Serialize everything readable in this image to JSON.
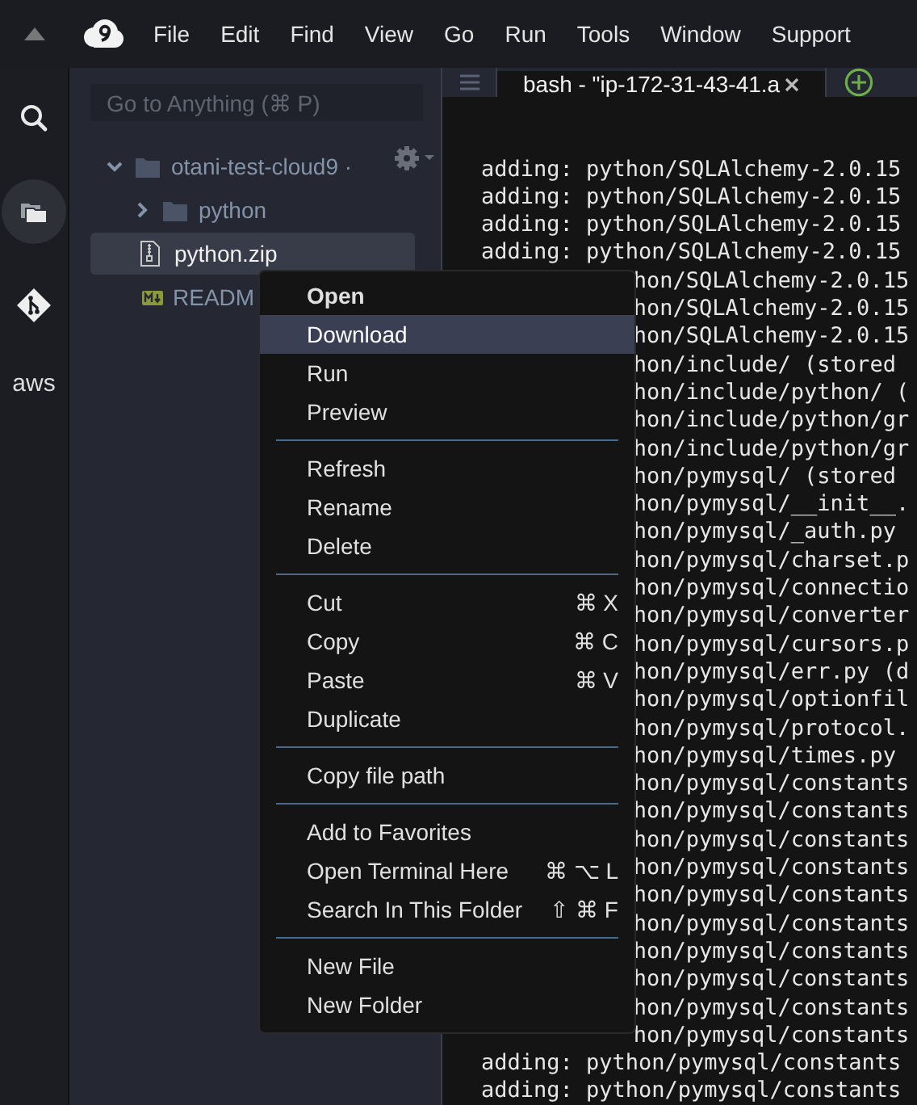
{
  "menubar": {
    "items": [
      "File",
      "Edit",
      "Find",
      "View",
      "Go",
      "Run",
      "Tools",
      "Window",
      "Support"
    ]
  },
  "rail": [
    {
      "kind": "search",
      "selected": false
    },
    {
      "kind": "files",
      "selected": true
    },
    {
      "kind": "git",
      "selected": false
    },
    {
      "kind": "aws",
      "label": "aws",
      "selected": false
    }
  ],
  "sidebar": {
    "search": {
      "placeholder": "Go to Anything (⌘ P)"
    },
    "tree": {
      "label": "otani-test-cloud9 ·",
      "expanded": true,
      "children": [
        {
          "label": "python",
          "kind": "folder",
          "expanded": false,
          "selected": false
        },
        {
          "label": "python.zip",
          "kind": "zip",
          "selected": true
        },
        {
          "label": "READM",
          "kind": "markdown",
          "selected": false
        }
      ]
    }
  },
  "terminal": {
    "tabs": [
      {
        "label": "bash - \"ip-172-31-43-41.a",
        "selected": true
      }
    ],
    "lines": [
      {
        "kind": "full",
        "text": "adding: python/SQLAlchemy-2.0.15"
      },
      {
        "kind": "full",
        "text": "adding: python/SQLAlchemy-2.0.15"
      },
      {
        "kind": "full",
        "text": "adding: python/SQLAlchemy-2.0.15"
      },
      {
        "kind": "full",
        "text": "adding: python/SQLAlchemy-2.0.15"
      },
      {
        "kind": "partial",
        "text": "hon/SQLAlchemy-2.0.15"
      },
      {
        "kind": "partial",
        "text": "hon/SQLAlchemy-2.0.15"
      },
      {
        "kind": "partial",
        "text": "hon/SQLAlchemy-2.0.15"
      },
      {
        "kind": "partial",
        "text": "hon/include/ (stored"
      },
      {
        "kind": "partial",
        "text": "hon/include/python/ ("
      },
      {
        "kind": "partial",
        "text": "hon/include/python/gr"
      },
      {
        "kind": "partial",
        "text": "hon/include/python/gr"
      },
      {
        "kind": "partial",
        "text": "hon/pymysql/ (stored"
      },
      {
        "kind": "partial",
        "text": "hon/pymysql/__init__."
      },
      {
        "kind": "partial",
        "text": "hon/pymysql/_auth.py"
      },
      {
        "kind": "partial",
        "text": "hon/pymysql/charset.p"
      },
      {
        "kind": "partial",
        "text": "hon/pymysql/connectio"
      },
      {
        "kind": "partial",
        "text": "hon/pymysql/converter"
      },
      {
        "kind": "partial",
        "text": "hon/pymysql/cursors.p"
      },
      {
        "kind": "partial",
        "text": "hon/pymysql/err.py (d"
      },
      {
        "kind": "partial",
        "text": "hon/pymysql/optionfil"
      },
      {
        "kind": "partial",
        "text": "hon/pymysql/protocol."
      },
      {
        "kind": "partial",
        "text": "hon/pymysql/times.py"
      },
      {
        "kind": "partial",
        "text": "hon/pymysql/constants"
      },
      {
        "kind": "partial",
        "text": "hon/pymysql/constants"
      },
      {
        "kind": "partial",
        "text": "hon/pymysql/constants"
      },
      {
        "kind": "partial",
        "text": "hon/pymysql/constants"
      },
      {
        "kind": "partial",
        "text": "hon/pymysql/constants"
      },
      {
        "kind": "partial",
        "text": "hon/pymysql/constants"
      },
      {
        "kind": "partial",
        "text": "hon/pymysql/constants"
      },
      {
        "kind": "partial",
        "text": "hon/pymysql/constants"
      },
      {
        "kind": "partial",
        "text": "hon/pymysql/constants"
      },
      {
        "kind": "partial",
        "text": "hon/pymysql/constants"
      },
      {
        "kind": "full",
        "text": "adding: python/pymysql/constants"
      },
      {
        "kind": "full",
        "text": "adding: python/pymysql/constants"
      }
    ]
  },
  "context_menu": {
    "items": [
      {
        "kind": "item",
        "label": "Open",
        "default": true,
        "selected": false
      },
      {
        "kind": "item",
        "label": "Download",
        "default": false,
        "selected": true
      },
      {
        "kind": "item",
        "label": "Run",
        "default": false,
        "selected": false
      },
      {
        "kind": "item",
        "label": "Preview",
        "default": false,
        "selected": false
      },
      {
        "kind": "separator"
      },
      {
        "kind": "item",
        "label": "Refresh",
        "default": false,
        "selected": false
      },
      {
        "kind": "item",
        "label": "Rename",
        "default": false,
        "selected": false
      },
      {
        "kind": "item",
        "label": "Delete",
        "default": false,
        "selected": false
      },
      {
        "kind": "separator"
      },
      {
        "kind": "item",
        "label": "Cut",
        "shortcut": "⌘ X",
        "default": false,
        "selected": false
      },
      {
        "kind": "item",
        "label": "Copy",
        "shortcut": "⌘ C",
        "default": false,
        "selected": false
      },
      {
        "kind": "item",
        "label": "Paste",
        "shortcut": "⌘ V",
        "default": false,
        "selected": false
      },
      {
        "kind": "item",
        "label": "Duplicate",
        "default": false,
        "selected": false
      },
      {
        "kind": "separator"
      },
      {
        "kind": "item",
        "label": "Copy file path",
        "default": false,
        "selected": false
      },
      {
        "kind": "separator"
      },
      {
        "kind": "item",
        "label": "Add to Favorites",
        "default": false,
        "selected": false
      },
      {
        "kind": "item",
        "label": "Open Terminal Here",
        "shortcut": "⌘ ⌥ L",
        "default": false,
        "selected": false
      },
      {
        "kind": "item",
        "label": "Search In This Folder",
        "shortcut": "⇧ ⌘ F",
        "default": false,
        "selected": false
      },
      {
        "kind": "separator"
      },
      {
        "kind": "item",
        "label": "New File",
        "default": false,
        "selected": false
      },
      {
        "kind": "item",
        "label": "New Folder",
        "default": false,
        "selected": false
      }
    ]
  }
}
